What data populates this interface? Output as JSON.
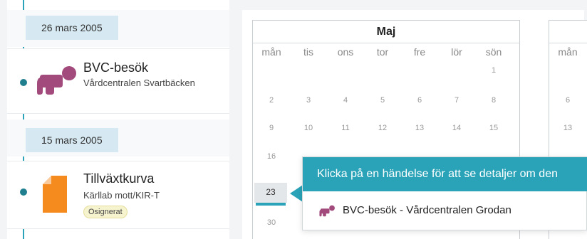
{
  "timeline": {
    "dates": [
      {
        "label": "26 mars 2005"
      },
      {
        "label": "15 mars 2005"
      }
    ],
    "events": [
      {
        "title": "BVC-besök",
        "subtitle": "Vårdcentralen Svartbäcken",
        "icon": "baby-icon"
      },
      {
        "title": "Tillväxtkurva",
        "subtitle": "Kärllab mott/KIR-T",
        "status": "Osignerat",
        "icon": "document-icon"
      }
    ]
  },
  "calendar": {
    "month": "Maj",
    "weekdays": [
      "mån",
      "tis",
      "ons",
      "tor",
      "fre",
      "lör",
      "sön"
    ],
    "second_month_weekday": "mån",
    "days": [
      "1",
      "2",
      "3",
      "4",
      "5",
      "6",
      "7",
      "8",
      "9",
      "10",
      "11",
      "12",
      "13",
      "14",
      "15",
      "16",
      "23",
      "30"
    ],
    "second_month_days": [
      "6",
      "13"
    ],
    "selected_day": "23"
  },
  "tooltip": {
    "header": "Klicka på en händelse för att se detaljer om den",
    "item": "BVC-besök - Vårdcentralen Grodan"
  },
  "colors": {
    "accent": "#2aa3b8",
    "baby_icon": "#a24a7c",
    "document_icon": "#f58a1f",
    "date_badge": "#d6e9f2",
    "status_badge": "#f6f3cf"
  }
}
